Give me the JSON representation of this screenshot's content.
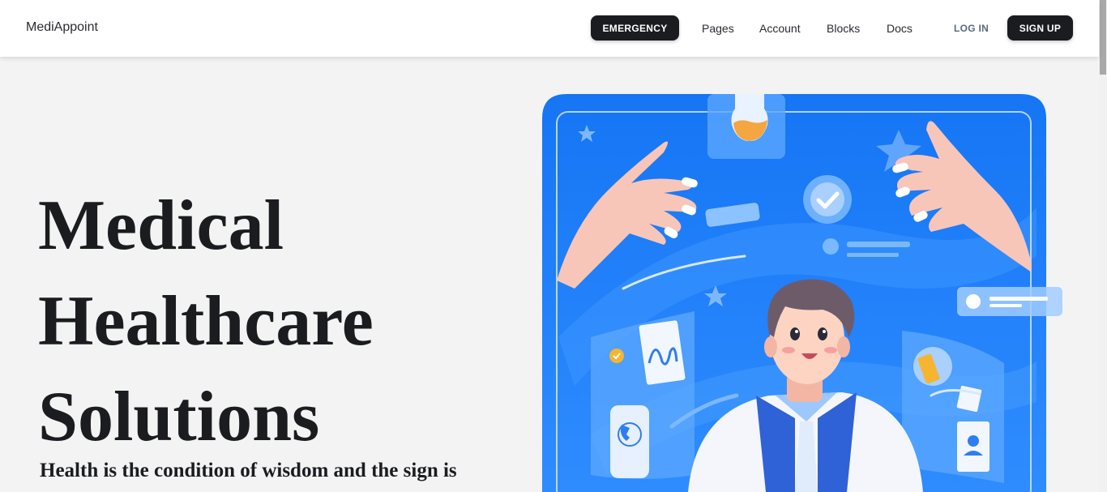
{
  "navbar": {
    "brand": "MediAppoint",
    "emergency_label": "EMERGENCY",
    "links": [
      "Pages",
      "Account",
      "Blocks",
      "Docs"
    ],
    "login_label": "LOG IN",
    "signup_label": "SIGN UP"
  },
  "hero": {
    "title_lines": [
      "Medical",
      "Healthcare",
      "Solutions"
    ],
    "subtitle": "Health is the condition of wisdom and the sign is"
  },
  "colors": {
    "accent_blue": "#1380f6",
    "dark_button": "#1b1c20",
    "background": "#f3f3f4"
  }
}
